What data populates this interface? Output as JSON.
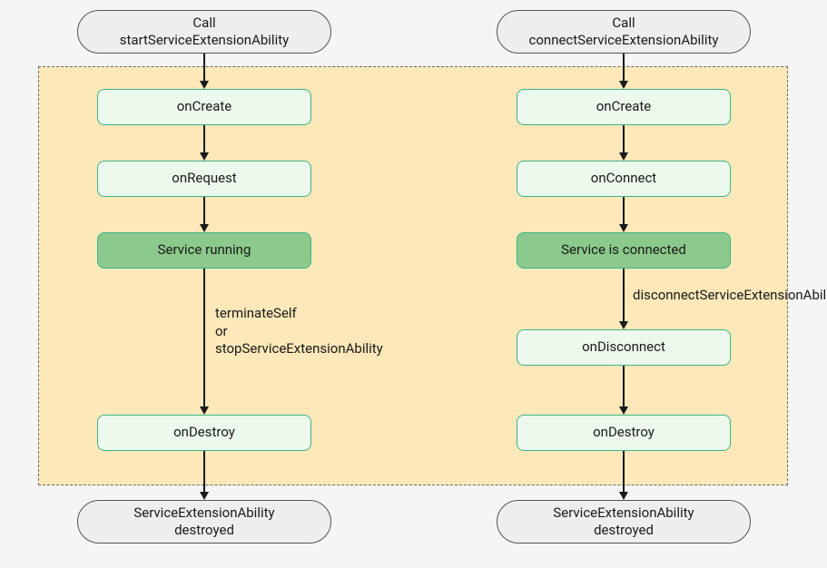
{
  "left": {
    "start_l1": "Call",
    "start_l2": "startServiceExtensionAbility",
    "onCreate": "onCreate",
    "onRequest": "onRequest",
    "running": "Service running",
    "terminate_l1": "terminateSelf",
    "terminate_l2": "or",
    "terminate_l3": "stopServiceExtensionAbility",
    "onDestroy": "onDestroy",
    "end_l1": "ServiceExtensionAbility",
    "end_l2": "destroyed"
  },
  "right": {
    "start_l1": "Call",
    "start_l2": "connectServiceExtensionAbility",
    "onCreate": "onCreate",
    "onConnect": "onConnect",
    "connected": "Service is connected",
    "disconnect": "disconnectServiceExtensionAbility",
    "onDisconnect": "onDisconnect",
    "onDestroy": "onDestroy",
    "end_l1": "ServiceExtensionAbility",
    "end_l2": "destroyed"
  }
}
